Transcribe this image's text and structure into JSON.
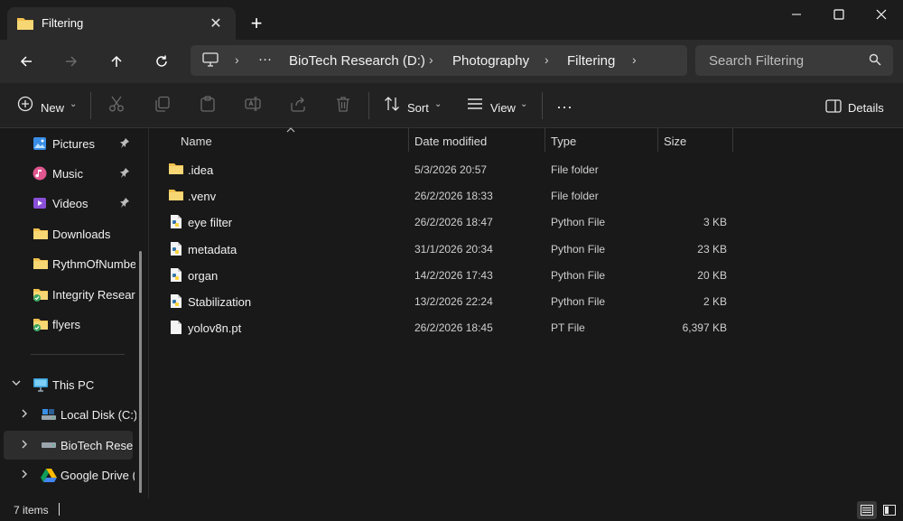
{
  "window": {
    "tab_title": "Filtering",
    "close_tab": "✕",
    "new_tab": "+"
  },
  "breadcrumb": {
    "more": "···",
    "items": [
      "BioTech Research (D:)",
      "Photography",
      "Filtering"
    ]
  },
  "search": {
    "placeholder": "Search Filtering"
  },
  "commands": {
    "new_label": "New",
    "sort_label": "Sort",
    "view_label": "View",
    "more": "···",
    "details_label": "Details"
  },
  "sidebar": {
    "quick_access": [
      {
        "label": "Pictures",
        "icon": "pictures-icon",
        "pinned": true
      },
      {
        "label": "Music",
        "icon": "music-icon",
        "pinned": true
      },
      {
        "label": "Videos",
        "icon": "videos-icon",
        "pinned": true
      },
      {
        "label": "Downloads",
        "icon": "folder-icon",
        "pinned": false
      },
      {
        "label": "RythmOfNumbe",
        "icon": "folder-icon",
        "pinned": false
      },
      {
        "label": "Integrity Researc",
        "icon": "shared-folder-icon",
        "pinned": false
      },
      {
        "label": "flyers",
        "icon": "shared-folder-icon",
        "pinned": false
      }
    ],
    "this_pc": "This PC",
    "drives": [
      {
        "label": "Local Disk (C:)",
        "icon": "drive-icon"
      },
      {
        "label": "BioTech Resea",
        "icon": "drive-icon"
      },
      {
        "label": "Google Drive (",
        "icon": "google-drive-icon"
      }
    ]
  },
  "columns": {
    "name": "Name",
    "date": "Date modified",
    "type": "Type",
    "size": "Size"
  },
  "files": [
    {
      "name": ".idea",
      "date": "5/3/2026 20:57",
      "type": "File folder",
      "size": "",
      "icon": "folder-icon"
    },
    {
      "name": ".venv",
      "date": "26/2/2026 18:33",
      "type": "File folder",
      "size": "",
      "icon": "folder-icon"
    },
    {
      "name": "eye filter",
      "date": "26/2/2026 18:47",
      "type": "Python File",
      "size": "3 KB",
      "icon": "python-file-icon"
    },
    {
      "name": "metadata",
      "date": "31/1/2026 20:34",
      "type": "Python File",
      "size": "23 KB",
      "icon": "python-file-icon"
    },
    {
      "name": "organ",
      "date": "14/2/2026 17:43",
      "type": "Python File",
      "size": "20 KB",
      "icon": "python-file-icon"
    },
    {
      "name": "Stabilization",
      "date": "13/2/2026 22:24",
      "type": "Python File",
      "size": "2 KB",
      "icon": "python-file-icon"
    },
    {
      "name": "yolov8n.pt",
      "date": "26/2/2026 18:45",
      "type": "PT File",
      "size": "6,397 KB",
      "icon": "file-icon"
    }
  ],
  "status": {
    "items_count": "7 items"
  },
  "colors": {
    "folder": "#f2c14e",
    "accent": "#4cc2ff",
    "background": "#191919"
  }
}
